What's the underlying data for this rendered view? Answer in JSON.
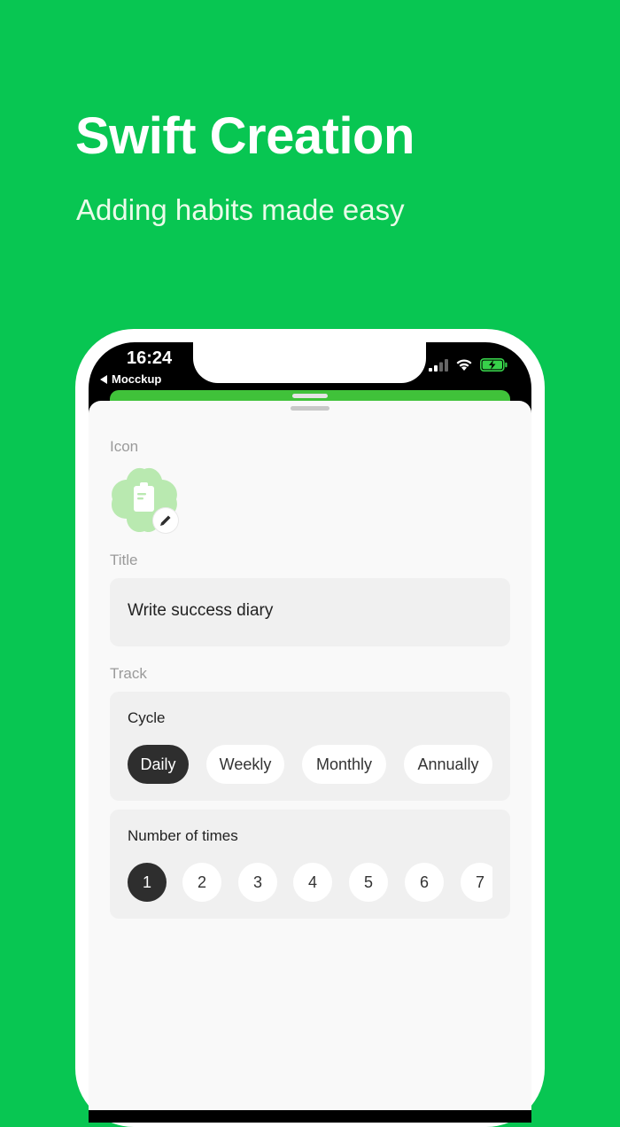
{
  "promo": {
    "headline": "Swift Creation",
    "subheadline": "Adding habits made easy"
  },
  "status_bar": {
    "time": "16:24",
    "back_label": "Mocckup"
  },
  "form": {
    "icon_label": "Icon",
    "icon_name": "clipboard-icon",
    "title_label": "Title",
    "title_value": "Write success diary",
    "track_label": "Track",
    "cycle": {
      "heading": "Cycle",
      "options": [
        "Daily",
        "Weekly",
        "Monthly",
        "Annually"
      ],
      "selected": "Daily"
    },
    "times": {
      "heading": "Number of times",
      "options": [
        "1",
        "2",
        "3",
        "4",
        "5",
        "6",
        "7"
      ],
      "selected": "1"
    }
  },
  "colors": {
    "background": "#08C652",
    "accent_sheet": "#40C23A",
    "icon_blob": "#B9E9B0",
    "selected_pill": "#2E2E2E"
  }
}
